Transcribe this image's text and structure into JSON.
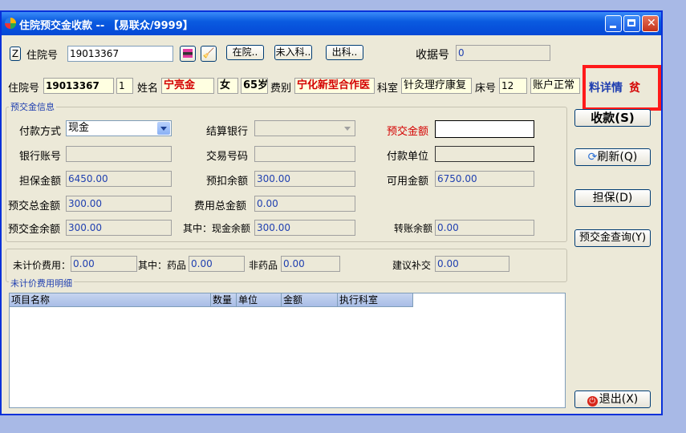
{
  "window": {
    "title": "住院预交金收款 -- 【易联众/9999】"
  },
  "toolbar": {
    "z_label": "Z",
    "inpatient_no_label": "住院号",
    "inpatient_no_value": "19013367",
    "btn_in": "在院..",
    "btn_not_admitted": "未入科..",
    "btn_out": "出科..",
    "receipt_no_label": "收据号",
    "receipt_no_value": "0"
  },
  "patient": {
    "inpatient_no_label": "住院号",
    "inpatient_no": "19013367",
    "times": "1",
    "name_label": "姓名",
    "name": "宁亮金",
    "gender": "女",
    "age": "65岁",
    "fee_type_label": "费别",
    "fee_type": "宁化新型合作医",
    "dept_label": "科室",
    "dept": "针灸理疗康复",
    "bed_label": "床号",
    "bed": "12",
    "account_status": "账户正常",
    "detail_label": "料详情",
    "poverty_label": "贫"
  },
  "deposit": {
    "legend": "预交金信息",
    "pay_method_label": "付款方式",
    "pay_method_value": "现金",
    "settle_bank_label": "结算银行",
    "deposit_amount_label": "预交金额",
    "bank_account_label": "银行账号",
    "trade_no_label": "交易号码",
    "pay_unit_label": "付款单位",
    "guarantee_label": "担保金额",
    "guarantee_value": "6450.00",
    "pre_deduct_label": "预扣余额",
    "pre_deduct_value": "300.00",
    "available_label": "可用金额",
    "available_value": "6750.00",
    "total_deposit_label": "预交总金额",
    "total_deposit_value": "300.00",
    "total_fee_label": "费用总金额",
    "total_fee_value": "0.00",
    "deposit_balance_label": "预交金余额",
    "deposit_balance_value": "300.00",
    "cash_balance_label": "其中：现金余额",
    "cash_balance_value": "300.00",
    "transfer_balance_label": "转账余额",
    "transfer_balance_value": "0.00"
  },
  "unpriced": {
    "fee_label": "未计价费用：",
    "fee_value": "0.00",
    "drug_label": "其中：药品",
    "drug_value": "0.00",
    "nondrug_label": "非药品",
    "nondrug_value": "0.00",
    "suggest_label": "建议补交",
    "suggest_value": "0.00"
  },
  "detail": {
    "legend": "未计价费用明细",
    "columns": [
      "项目名称",
      "数量",
      "单位",
      "金额",
      "执行科室"
    ]
  },
  "actions": {
    "collect": "收款(S)",
    "refresh": "刷新(Q)",
    "guarantee": "担保(D)",
    "deposit_query": "预交金查询(Y)",
    "exit": "退出(X)"
  },
  "colors": {
    "title_bar": "#0a5be0",
    "highlight_border": "#ff1a1a",
    "value_blue": "#1f3fb0"
  }
}
